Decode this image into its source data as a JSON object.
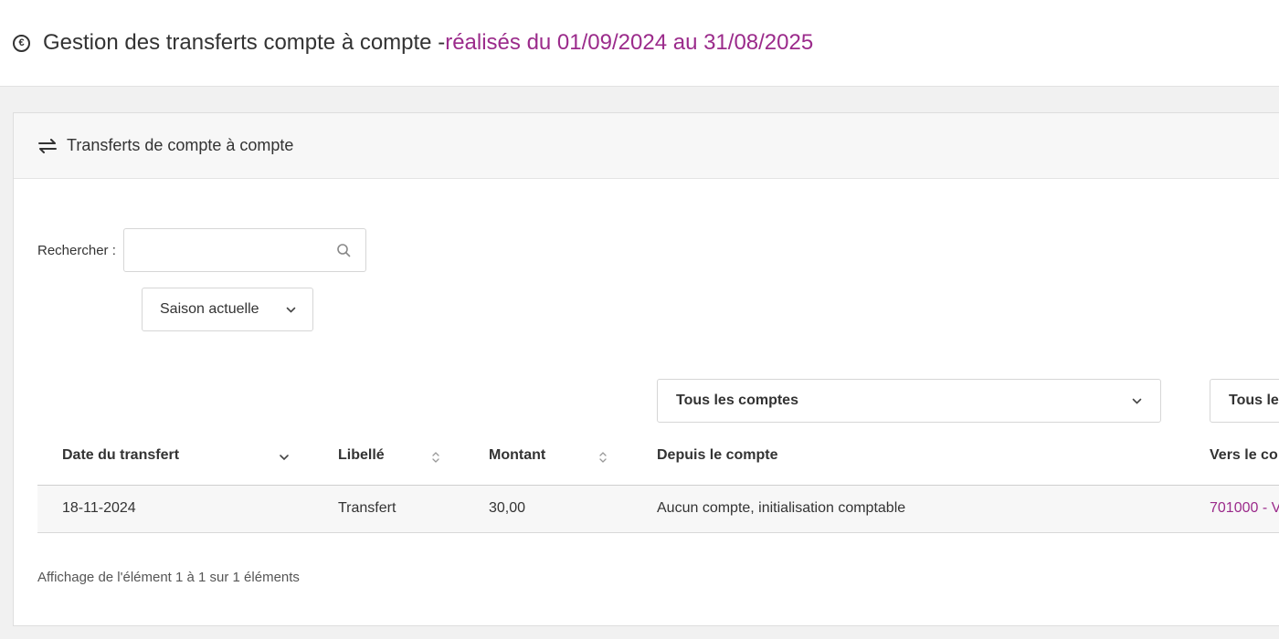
{
  "header": {
    "title": "Gestion des transferts compte à compte - ",
    "title_accent": "réalisés du 01/09/2024 au 31/08/2025",
    "icon": "euro-circle-icon"
  },
  "panel": {
    "title": "Transferts de compte à compte",
    "icon": "swap-arrows-icon"
  },
  "search": {
    "label": "Rechercher :",
    "value": "",
    "placeholder": ""
  },
  "season_select": {
    "selected": "Saison actuelle"
  },
  "filters": {
    "from_account": "Tous les comptes",
    "to_account": "Tous les"
  },
  "table": {
    "columns": [
      "Date du transfert",
      "Libellé",
      "Montant",
      "Depuis le compte",
      "Vers le co"
    ],
    "rows": [
      {
        "date": "18-11-2024",
        "label": "Transfert",
        "amount": "30,00",
        "from": "Aucun compte, initialisation comptable",
        "to": "701000 - V"
      }
    ]
  },
  "footer": {
    "info": "Affichage de l'élément 1 à 1 sur 1 éléments"
  },
  "colors": {
    "accent": "#9b2b8b"
  }
}
